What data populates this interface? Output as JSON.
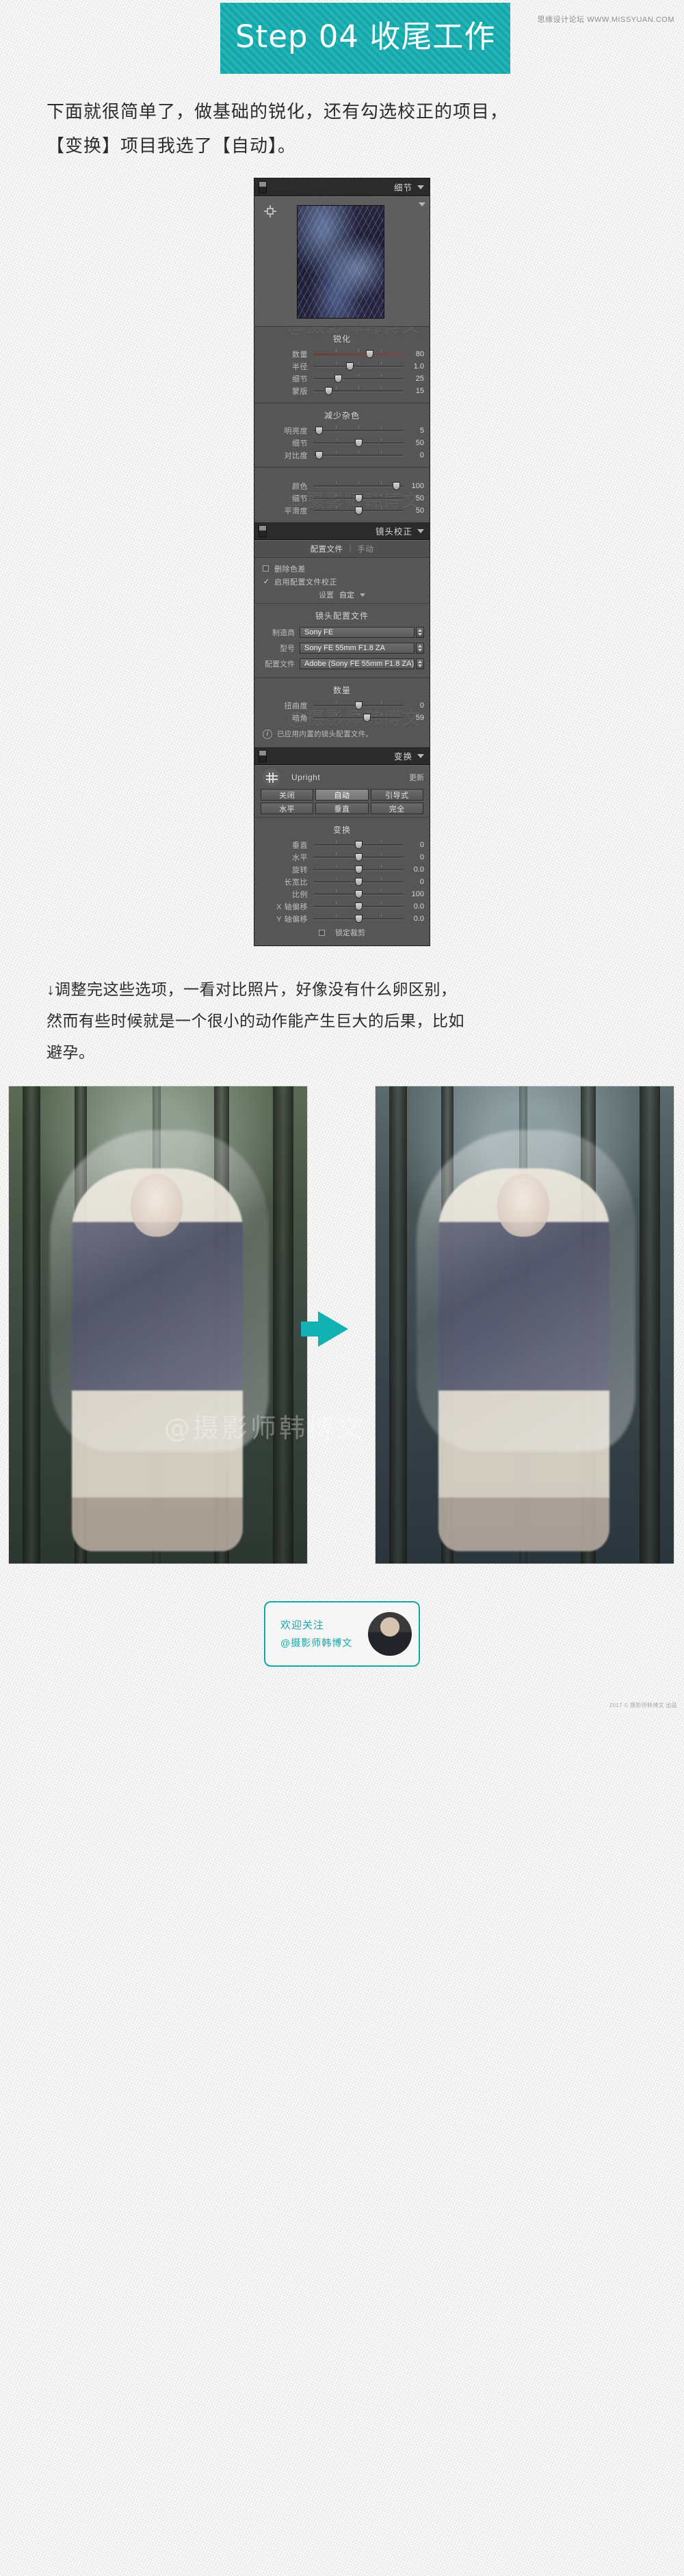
{
  "header": {
    "step_title": "Step 04 收尾工作",
    "site_credit": "思缘设计论坛 WWW.MISSYUAN.COM"
  },
  "intro": {
    "line1": "下面就很简单了，做基础的锐化，还有勾选校正的项目，",
    "line2": "【变换】项目我选了【自动】。"
  },
  "watermark": "@摄影师韩博文",
  "panels": {
    "detail": {
      "title": "细节",
      "sections": [
        {
          "name": "锐化",
          "sliders": [
            {
              "label": "数量",
              "value": "80",
              "pos": 62,
              "colored": true
            },
            {
              "label": "半径",
              "value": "1.0",
              "pos": 40
            },
            {
              "label": "细节",
              "value": "25",
              "pos": 27
            },
            {
              "label": "蒙版",
              "value": "15",
              "pos": 17
            }
          ]
        },
        {
          "name": "减少杂色",
          "sliders": [
            {
              "label": "明亮度",
              "value": "5",
              "pos": 6
            },
            {
              "label": "细节",
              "value": "50",
              "pos": 50
            },
            {
              "label": "对比度",
              "value": "0",
              "pos": 6
            }
          ]
        },
        {
          "name": "",
          "sliders": [
            {
              "label": "颜色",
              "value": "100",
              "pos": 92
            },
            {
              "label": "细节",
              "value": "50",
              "pos": 50
            },
            {
              "label": "平滑度",
              "value": "50",
              "pos": 50
            }
          ]
        }
      ]
    },
    "lens": {
      "title": "镜头校正",
      "tabs": {
        "profile": "配置文件",
        "separator": "|",
        "manual": "手动"
      },
      "checks": [
        {
          "label": "删除色差",
          "checked": false
        },
        {
          "label": "启用配置文件校正",
          "checked": true
        }
      ],
      "setting": {
        "label": "设置",
        "value": "自定",
        "caret": "chevron-down-icon"
      },
      "profile_title": "镜头配置文件",
      "dropdowns": [
        {
          "label": "制造商",
          "value": "Sony FE"
        },
        {
          "label": "型号",
          "value": "Sony FE 55mm F1.8 ZA"
        },
        {
          "label": "配置文件",
          "value": "Adobe (Sony FE 55mm F1.8 ZA)"
        }
      ],
      "amount_title": "数量",
      "sliders": [
        {
          "label": "扭曲度",
          "value": "0",
          "pos": 50
        },
        {
          "label": "暗角",
          "value": "59",
          "pos": 59
        }
      ],
      "info": "已应用内置的镜头配置文件。"
    },
    "transform": {
      "title": "变换",
      "upright_label": "Upright",
      "refresh_label": "更新",
      "buttons_row1": [
        {
          "label": "关闭",
          "active": false
        },
        {
          "label": "自动",
          "active": true
        },
        {
          "label": "引导式",
          "active": false
        }
      ],
      "buttons_row2": [
        {
          "label": "水平",
          "active": false
        },
        {
          "label": "垂直",
          "active": false
        },
        {
          "label": "完全",
          "active": false
        }
      ],
      "section_title": "变换",
      "sliders": [
        {
          "label": "垂直",
          "value": "0",
          "pos": 50
        },
        {
          "label": "水平",
          "value": "0",
          "pos": 50
        },
        {
          "label": "旋转",
          "value": "0.0",
          "pos": 50
        },
        {
          "label": "长宽比",
          "value": "0",
          "pos": 50
        },
        {
          "label": "比例",
          "value": "100",
          "pos": 50
        },
        {
          "label": "X 轴偏移",
          "value": "0.0",
          "pos": 50
        },
        {
          "label": "Y 轴偏移",
          "value": "0.0",
          "pos": 50
        }
      ],
      "lock_crop": {
        "label": "锁定裁剪",
        "checked": false
      }
    }
  },
  "note": {
    "line1": "↓调整完这些选项，一看对比照片，好像没有什么卵区别，",
    "line2": "然而有些时候就是一个很小的动作能产生巨大的后果，比如",
    "line3": "避孕。"
  },
  "compare": {
    "before_alt": "修图前照片",
    "after_alt": "修图后照片",
    "arrow": "arrow-right-icon"
  },
  "footer": {
    "line1": "欢迎关注",
    "line2": "@摄影师韩博文",
    "bottom_credit": "2017 © 摄影师韩博文 出品"
  }
}
